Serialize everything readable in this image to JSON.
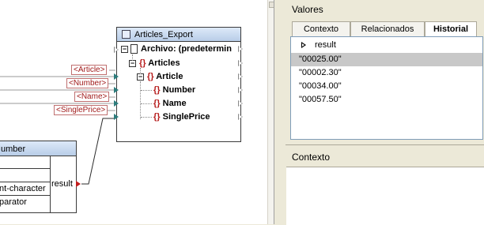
{
  "mapping": {
    "tags": {
      "article": "<Article>",
      "number": "<Number>",
      "name": "<Name>",
      "single_price": "<SinglePrice>"
    },
    "component": {
      "title": "Articles_Export",
      "file_row": "Archivo: (predetermin",
      "nodes": [
        "Articles",
        "Article",
        "Number",
        "Name",
        "SinglePrice"
      ]
    },
    "function": {
      "title_partial": "umber",
      "inputs": [
        "",
        "",
        "nt-character",
        "parator"
      ],
      "output": "result"
    }
  },
  "valores": {
    "title": "Valores",
    "tabs": [
      "Contexto",
      "Relacionados",
      "Historial"
    ],
    "active_tab": "Historial",
    "list_header": "result",
    "items": [
      "\"00025.00\"",
      "\"00002.30\"",
      "\"00034.00\"",
      "\"00057.50\""
    ],
    "selected_index": 0
  },
  "contexto": {
    "title": "Contexto"
  },
  "colors": {
    "tag_text": "#a11b1b",
    "brace": "#b51a1a",
    "port_connected": "#2e7d7d",
    "result_port": "#c21c1c",
    "header_gradient_top": "#dde9f8",
    "header_gradient_bottom": "#b8cde8"
  }
}
